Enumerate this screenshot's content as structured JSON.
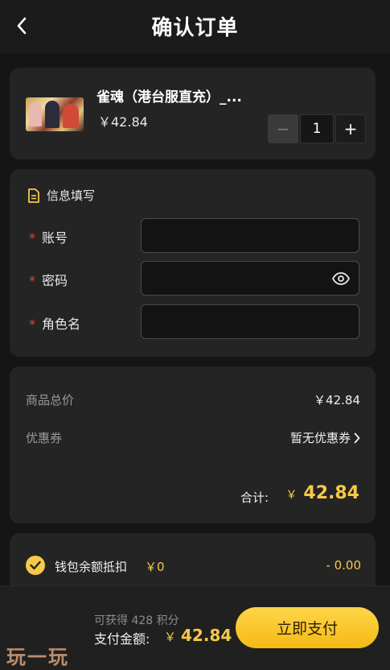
{
  "header": {
    "title": "确认订单",
    "back_icon": "chevron-left-icon"
  },
  "product": {
    "name": "雀魂（港台服直充）_...",
    "price": "￥42.84",
    "quantity": "1",
    "minus": "−",
    "plus": "+"
  },
  "info": {
    "heading": "信息填写",
    "required_mark": "*",
    "fields": [
      {
        "label": "账号",
        "value": ""
      },
      {
        "label": "密码",
        "value": ""
      },
      {
        "label": "角色名",
        "value": ""
      }
    ]
  },
  "pricing": {
    "subtotal_label": "商品总价",
    "subtotal_value": "￥42.84",
    "coupon_label": "优惠券",
    "coupon_value": "暂无优惠券",
    "total_label": "合计:",
    "total_currency": "￥",
    "total_value": "42.84"
  },
  "wallet": {
    "label": "钱包余额抵扣",
    "balance": "￥0",
    "deduct": "- 0.00",
    "checked": true
  },
  "footer": {
    "points_text": "可获得 428 积分",
    "pay_label": "支付金额:",
    "pay_currency": "￥",
    "pay_value": "42.84",
    "pay_button": "立即支付"
  },
  "watermark": "玩一玩",
  "colors": {
    "accent": "#f7c948",
    "required": "#e0463f",
    "background": "#151515",
    "card": "#242424"
  }
}
